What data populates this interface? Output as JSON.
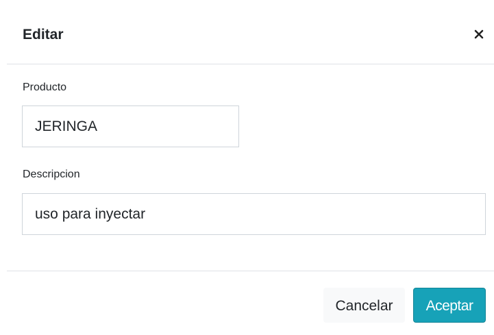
{
  "modal": {
    "title": "Editar",
    "close_icon": "close-icon"
  },
  "form": {
    "producto": {
      "label": "Producto",
      "value": "JERINGA"
    },
    "descripcion": {
      "label": "Descripcion",
      "value": "uso para inyectar"
    }
  },
  "footer": {
    "cancel_label": "Cancelar",
    "accept_label": "Aceptar"
  },
  "colors": {
    "accent": "#17a2b8",
    "border": "#ced4da",
    "divider": "#dee2e6"
  }
}
